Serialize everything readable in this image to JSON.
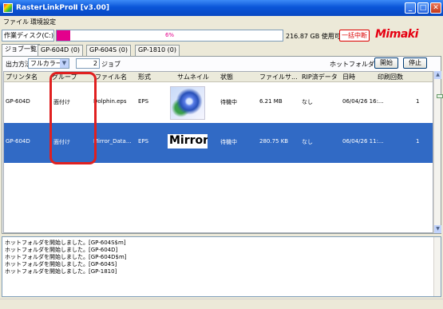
{
  "window": {
    "title": "RasterLinkProⅡ [v3.00]"
  },
  "menu": [
    "ファイル",
    "環境設定"
  ],
  "disk": {
    "label": "作業ディスク(C:)",
    "percent_text": "6%",
    "percent": 6,
    "free_text": "216.87 GB 使用可能",
    "stop_all_label": "一括中断"
  },
  "logo": {
    "text": "Mimaki",
    "color": "#e60012"
  },
  "tabs": [
    "ジョブ一覧",
    "GP-604D (0)",
    "GP-604S (0)",
    "GP-1810 (0)"
  ],
  "toolbar": {
    "output_label": "出力方法",
    "output_value": "フルカラー",
    "job_count": "2",
    "job_unit": "ジョブ",
    "hotfolder_label": "ホットフォルダ",
    "start_label": "開始",
    "stop_label": "停止"
  },
  "columns": [
    "プリンタ名",
    "グループ",
    "ファイル名",
    "形式",
    "サムネイル",
    "状態",
    "ファイルサ...",
    "RIP済データ",
    "日時",
    "印刷回数"
  ],
  "rows": [
    {
      "printer": "GP-604D",
      "group": "面付け",
      "filename": "Dolphin.eps",
      "format": "EPS",
      "thumbnail": "dolphin",
      "status": "待機中",
      "filesize": "6.21 MB",
      "rip": "なし",
      "datetime": "06/04/26 16:...",
      "count": "1",
      "selected": false
    },
    {
      "printer": "GP-604D",
      "group": "面付け",
      "filename": "Mirror_Data...",
      "format": "EPS",
      "thumbnail_text": "Mirror",
      "status": "待機中",
      "filesize": "280.75 KB",
      "rip": "なし",
      "datetime": "06/04/26 11:...",
      "count": "1",
      "selected": true
    }
  ],
  "log": [
    "ホットフォルダを開始しました。[GP-604S$m]",
    "ホットフォルダを開始しました。[GP-604D]",
    "ホットフォルダを開始しました。[GP-604D$m]",
    "ホットフォルダを開始しました。[GP-604S]",
    "ホットフォルダを開始しました。[GP-1810]"
  ],
  "colors": {
    "title_bar": "#0a55d8",
    "selection": "#316ac5",
    "disk_fill": "#e4008c",
    "annotation": "#e02020"
  },
  "icons": {
    "close": "close-icon",
    "minimize": "minimize-icon",
    "maximize": "maximize-icon",
    "dropdown": "chevron-down-icon",
    "scroll_up": "scroll-up-icon",
    "scroll_down": "scroll-down-icon"
  }
}
